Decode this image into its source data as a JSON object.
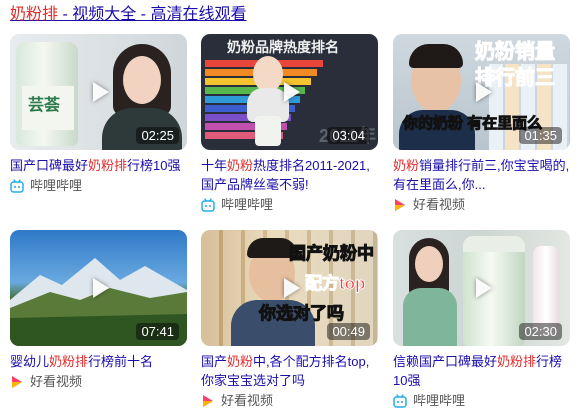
{
  "header": {
    "kw": "奶粉排",
    "rest": " - 视频大全 - 高清在线观看"
  },
  "videos": [
    {
      "duration": "02:25",
      "title_pre": "国产口碑最好",
      "title_kw": "奶粉排",
      "title_post": "行榜10强",
      "source": "哔哩哔哩",
      "source_icon": "bilibili-icon",
      "overlay": [
        "芸荟"
      ]
    },
    {
      "duration": "03:04",
      "title_pre": "十年",
      "title_kw": "奶粉",
      "title_post": "热度排名2011-2021,国产品牌丝毫不弱!",
      "source": "哔哩哔哩",
      "source_icon": "bilibili-icon",
      "overlay": [
        "奶粉品牌热度排名",
        "2011年"
      ]
    },
    {
      "duration": "01:35",
      "title_pre": "",
      "title_kw": "奶粉",
      "title_post": "销量排行前三,你宝宝喝的,有在里面么,你...",
      "source": "好看视频",
      "source_icon": "haokan-icon",
      "overlay": [
        "奶粉销量",
        "排行前三",
        "你的奶粉 有在里面么"
      ]
    },
    {
      "duration": "07:41",
      "title_pre": "婴幼儿",
      "title_kw": "奶粉排",
      "title_post": "行榜前十名",
      "source": "好看视频",
      "source_icon": "haokan-icon",
      "overlay": []
    },
    {
      "duration": "00:49",
      "title_pre": "国产",
      "title_kw": "奶粉",
      "title_post": "中,各个配方排名top,你家宝宝选对了吗",
      "source": "好看视频",
      "source_icon": "haokan-icon",
      "overlay": [
        "国产奶粉中",
        "配方top",
        "你选对了吗"
      ]
    },
    {
      "duration": "02:30",
      "title_pre": "信赖国产口碑最好",
      "title_kw": "奶粉排",
      "title_post": "行榜10强",
      "source": "哔哩哔哩",
      "source_icon": "bilibili-icon",
      "overlay": []
    }
  ],
  "colors": {
    "link": "#1a0dab",
    "highlight": "#e22c2c",
    "bilibili": "#23ade5",
    "haokan_a": "#ff3f6c",
    "haokan_b": "#ffb400"
  }
}
